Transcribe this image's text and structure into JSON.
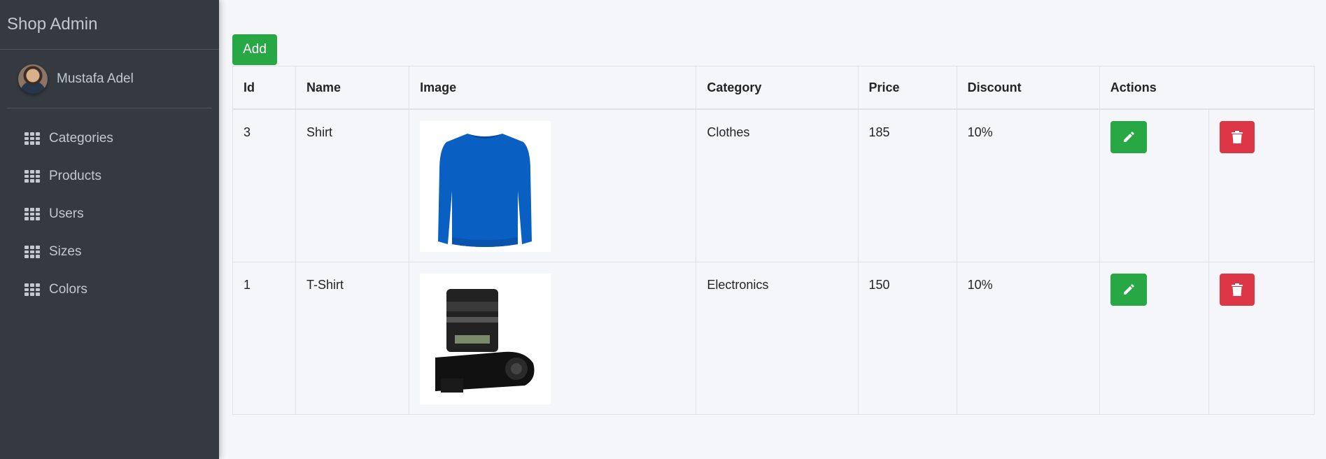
{
  "sidebar": {
    "brand": "Shop Admin",
    "user_name": "Mustafa Adel",
    "items": [
      {
        "label": "Categories",
        "icon": "grid-icon"
      },
      {
        "label": "Products",
        "icon": "grid-icon"
      },
      {
        "label": "Users",
        "icon": "grid-icon"
      },
      {
        "label": "Sizes",
        "icon": "grid-icon"
      },
      {
        "label": "Colors",
        "icon": "grid-icon"
      }
    ]
  },
  "toolbar": {
    "add_label": "Add"
  },
  "table": {
    "headers": [
      "Id",
      "Name",
      "Image",
      "Category",
      "Price",
      "Discount",
      "Actions"
    ],
    "rows": [
      {
        "id": "3",
        "name": "Shirt",
        "image": "sweater-photo",
        "category": "Clothes",
        "price": "185",
        "discount": "10%"
      },
      {
        "id": "1",
        "name": "T-Shirt",
        "image": "camera-photo",
        "category": "Electronics",
        "price": "150",
        "discount": "10%"
      }
    ]
  },
  "colors": {
    "sidebar_bg": "#343a40",
    "success": "#28a745",
    "danger": "#dc3545",
    "page_bg": "#f4f6f9"
  }
}
